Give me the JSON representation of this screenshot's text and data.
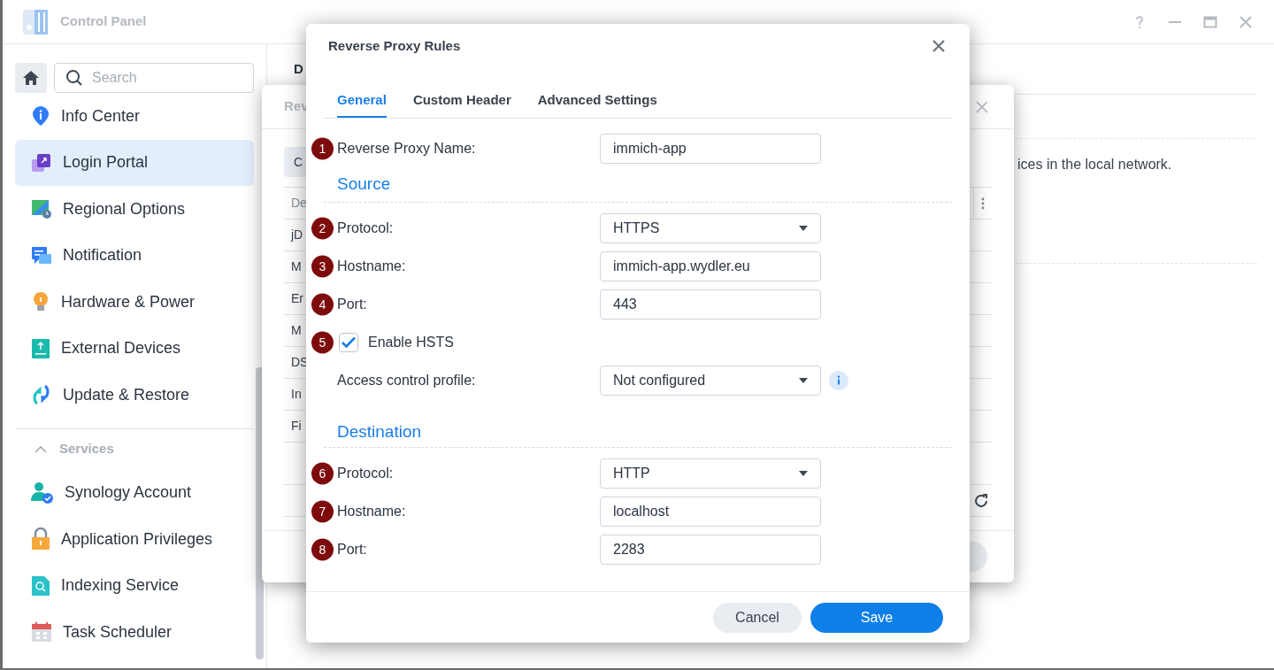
{
  "window": {
    "title": "Control Panel"
  },
  "sidebar": {
    "search_placeholder": "Search",
    "items": [
      {
        "label": "Info Center",
        "selected": false
      },
      {
        "label": "Login Portal",
        "selected": true
      },
      {
        "label": "Regional Options",
        "selected": false
      },
      {
        "label": "Notification",
        "selected": false
      },
      {
        "label": "Hardware & Power",
        "selected": false
      },
      {
        "label": "External Devices",
        "selected": false
      },
      {
        "label": "Update & Restore",
        "selected": false
      }
    ],
    "section": {
      "title": "Services",
      "expanded": true,
      "items": [
        {
          "label": "Synology Account",
          "selected": false
        },
        {
          "label": "Application Privileges",
          "selected": false
        },
        {
          "label": "Indexing Service",
          "selected": false
        },
        {
          "label": "Task Scheduler",
          "selected": false
        }
      ]
    }
  },
  "main": {
    "header": "D",
    "description": "ices in the local network."
  },
  "background_dialog": {
    "title": "Rev",
    "button": "C",
    "header_cell": "De",
    "rows": [
      "jD",
      "M",
      "Er",
      "M",
      "DS",
      "In",
      "Fi"
    ]
  },
  "dialog": {
    "title": "Reverse Proxy Rules",
    "tabs": [
      {
        "label": "General",
        "selected": true
      },
      {
        "label": "Custom Header",
        "selected": false
      },
      {
        "label": "Advanced Settings",
        "selected": false
      }
    ],
    "fields": [
      {
        "kind": "text",
        "marker": "1",
        "label": "Reverse Proxy Name:",
        "value": "immich-app"
      },
      {
        "kind": "section",
        "label": "Source"
      },
      {
        "kind": "select",
        "marker": "2",
        "label": "Protocol:",
        "value": "HTTPS"
      },
      {
        "kind": "text",
        "marker": "3",
        "label": "Hostname:",
        "value": "immich-app.wydler.eu"
      },
      {
        "kind": "text",
        "marker": "4",
        "label": "Port:",
        "value": "443"
      },
      {
        "kind": "checkbox",
        "marker": "5",
        "label": "Enable HSTS",
        "checked": true
      },
      {
        "kind": "select",
        "label": "Access control profile:",
        "value": "Not configured",
        "info": true
      },
      {
        "kind": "section",
        "label": "Destination"
      },
      {
        "kind": "select",
        "marker": "6",
        "label": "Protocol:",
        "value": "HTTP"
      },
      {
        "kind": "text",
        "marker": "7",
        "label": "Hostname:",
        "value": "localhost"
      },
      {
        "kind": "text",
        "marker": "8",
        "label": "Port:",
        "value": "2283"
      }
    ],
    "buttons": [
      {
        "label": "Cancel",
        "kind": "secondary"
      },
      {
        "label": "Save",
        "kind": "primary"
      }
    ]
  }
}
